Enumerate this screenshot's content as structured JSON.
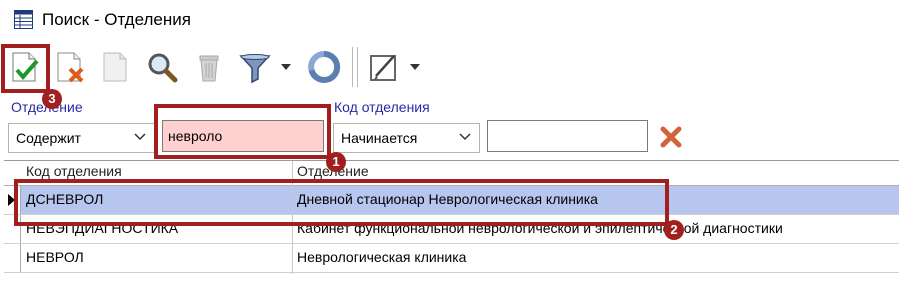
{
  "window": {
    "title": "Поиск - Отделения"
  },
  "icons": [
    "window-table-icon",
    "accept-check-icon",
    "clear-filter-icon",
    "blank-document-icon",
    "search-magnifier-icon",
    "trash-icon",
    "funnel-filter-icon",
    "dropdown-arrow-icon",
    "refresh-icon",
    "edit-icon"
  ],
  "filters": {
    "dept_label": "Отделение",
    "dept_condition": "Содержит",
    "dept_value": "невроло",
    "code_label": "Код отделения",
    "code_condition": "Начинается",
    "code_value": ""
  },
  "table": {
    "headers": [
      "Код отделения",
      "Отделение"
    ],
    "rows": [
      {
        "code": "ДСНЕВРОЛ",
        "name": "Дневной стационар Неврологическая клиника",
        "selected": true
      },
      {
        "code": "НЕВЭПДИАГНОСТИКА",
        "name": "Кабинет функциональной неврологической и эпилептической диагностики",
        "selected": false
      },
      {
        "code": "НЕВРОЛ",
        "name": "Неврологическая клиника",
        "selected": false
      }
    ]
  },
  "annotations": {
    "badge1": "1",
    "badge2": "2",
    "badge3": "3"
  },
  "colors": {
    "annotation": "#a21f1f",
    "selection": "#b7c6ee",
    "label": "#2a2aa8"
  }
}
